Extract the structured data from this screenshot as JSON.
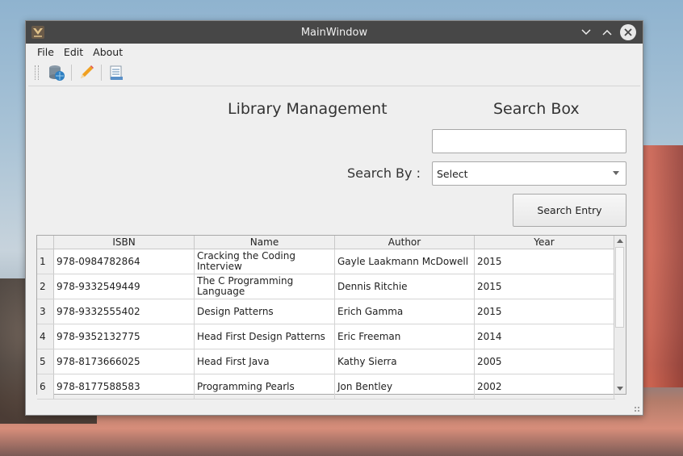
{
  "window": {
    "title": "MainWindow"
  },
  "menu": [
    "File",
    "Edit",
    "About"
  ],
  "toolbar": {
    "icons": [
      "database-globe-icon",
      "pencil-icon",
      "document-list-icon"
    ]
  },
  "headings": {
    "main": "Library Management",
    "search_box": "Search Box"
  },
  "search": {
    "input_value": "",
    "search_by_label": "Search By :",
    "select_value": "Select",
    "button_label": "Search Entry"
  },
  "table": {
    "columns": [
      "ISBN",
      "Name",
      "Author",
      "Year"
    ],
    "rows": [
      {
        "n": "1",
        "isbn": "978-0984782864",
        "name": "Cracking the Coding Interview",
        "author": "Gayle Laakmann McDowell",
        "year": "2015"
      },
      {
        "n": "2",
        "isbn": "978-9332549449",
        "name": "The C Programming Language",
        "author": "Dennis Ritchie",
        "year": "2015"
      },
      {
        "n": "3",
        "isbn": "978-9332555402",
        "name": "Design Patterns",
        "author": "Erich Gamma",
        "year": "2015"
      },
      {
        "n": "4",
        "isbn": "978-9352132775",
        "name": "Head First Design Patterns",
        "author": "Eric Freeman",
        "year": "2014"
      },
      {
        "n": "5",
        "isbn": "978-8173666025",
        "name": "Head First Java",
        "author": "Kathy Sierra",
        "year": "2005"
      },
      {
        "n": "6",
        "isbn": "978-8177588583",
        "name": "Programming Pearls",
        "author": "Jon Bentley",
        "year": "2002"
      }
    ]
  },
  "colors": {
    "titlebar": "#474747",
    "window_bg": "#efefef"
  }
}
